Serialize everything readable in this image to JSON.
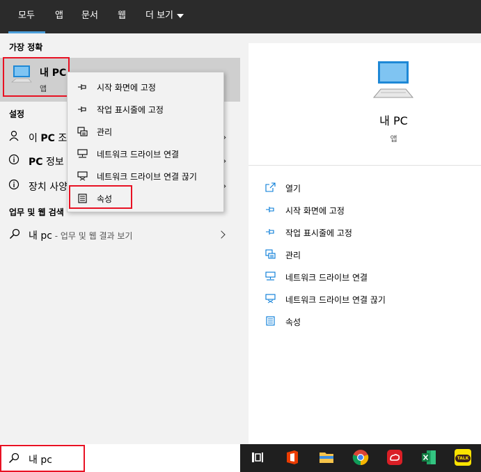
{
  "tabs": [
    "모두",
    "앱",
    "문서",
    "웹",
    "더 보기"
  ],
  "left": {
    "best_match_header": "가장 정확",
    "best_match": {
      "title": "내 PC",
      "subtitle": "앱"
    },
    "settings_header": "설정",
    "settings_items": [
      {
        "prefix": "이 ",
        "bold": "PC",
        "text": " 조"
      },
      {
        "prefix": "",
        "bold": "PC",
        "text": " 정보"
      },
      {
        "prefix": "",
        "bold": "",
        "text": "장치 사양"
      }
    ],
    "web_header": "업무 및 웹 검색",
    "web_item": {
      "query": "내 pc",
      "suffix": " - 업무 및 웹 결과 보기"
    }
  },
  "context_menu": [
    {
      "label": "시작 화면에 고정",
      "icon": "pin-icon"
    },
    {
      "label": "작업 표시줄에 고정",
      "icon": "pin-icon"
    },
    {
      "label": "관리",
      "icon": "manage-icon"
    },
    {
      "label": "네트워크 드라이브 연결",
      "icon": "network-drive-icon"
    },
    {
      "label": "네트워크 드라이브 연결 끊기",
      "icon": "network-drive-disconnect-icon"
    },
    {
      "label": "속성",
      "icon": "properties-icon"
    }
  ],
  "right": {
    "title": "내 PC",
    "subtitle": "앱",
    "actions": [
      {
        "label": "열기",
        "icon": "open-icon"
      },
      {
        "label": "시작 화면에 고정",
        "icon": "pin-icon"
      },
      {
        "label": "작업 표시줄에 고정",
        "icon": "pin-icon"
      },
      {
        "label": "관리",
        "icon": "manage-icon"
      },
      {
        "label": "네트워크 드라이브 연결",
        "icon": "network-drive-icon"
      },
      {
        "label": "네트워크 드라이브 연결 끊기",
        "icon": "network-drive-disconnect-icon"
      },
      {
        "label": "속성",
        "icon": "properties-icon"
      }
    ]
  },
  "search": {
    "query": "내 pc"
  },
  "taskbar_apps": [
    "task-view-icon",
    "office-icon",
    "file-explorer-icon",
    "chrome-icon",
    "creative-cloud-icon",
    "excel-icon",
    "kakaotalk-icon"
  ],
  "kakao_label": "TALK",
  "colors": {
    "accent": "#4c9ed9",
    "highlight": "#e81123",
    "icon_blue": "#0078d7"
  }
}
